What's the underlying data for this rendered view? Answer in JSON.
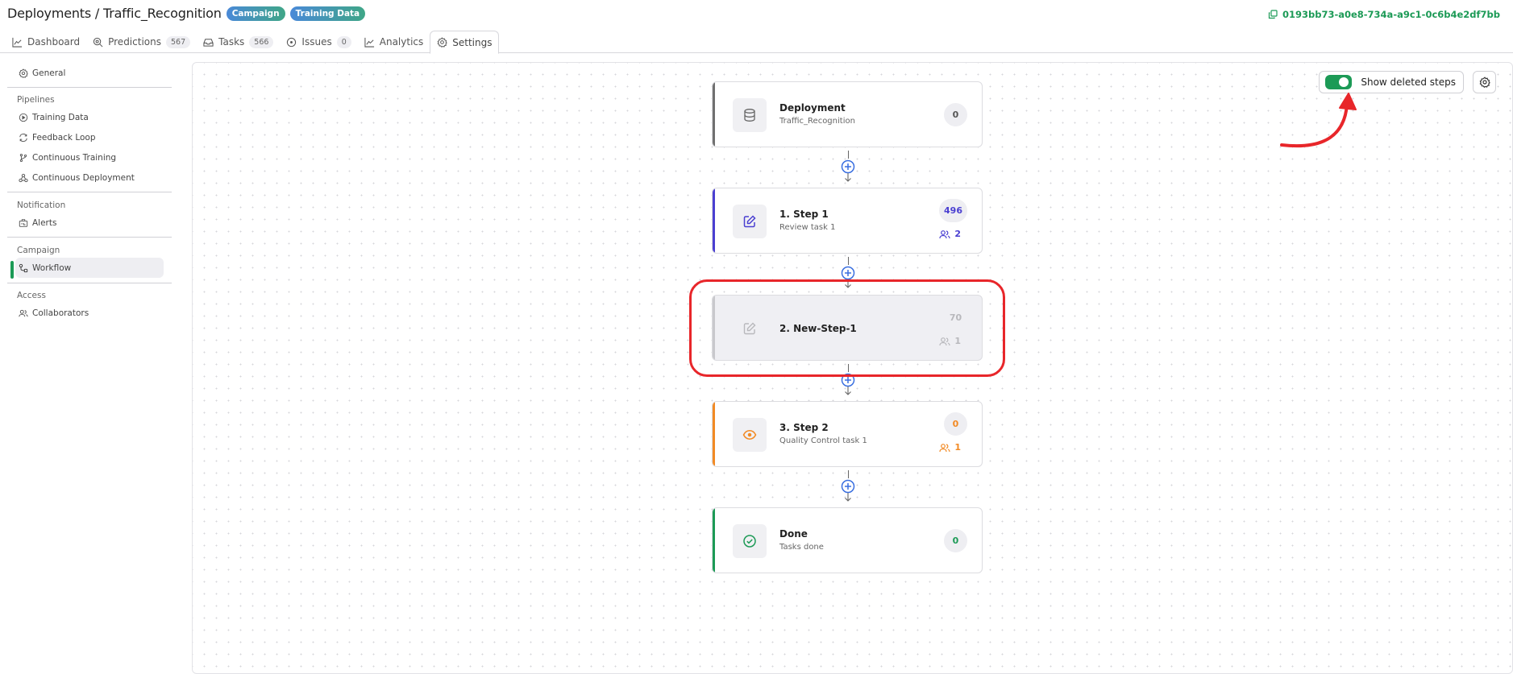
{
  "header": {
    "title": "Deployments / Traffic_Recognition",
    "badges": [
      "Campaign",
      "Training Data"
    ],
    "uuid": "0193bb73-a0e8-734a-a9c1-0c6b4e2df7bb"
  },
  "tabs": [
    {
      "label": "Dashboard",
      "icon": "chart-line-icon"
    },
    {
      "label": "Predictions",
      "count": "567",
      "icon": "search-icon"
    },
    {
      "label": "Tasks",
      "count": "566",
      "icon": "inbox-icon"
    },
    {
      "label": "Issues",
      "count": "0",
      "icon": "dot-circle-icon"
    },
    {
      "label": "Analytics",
      "icon": "chart-line-icon"
    },
    {
      "label": "Settings",
      "icon": "gear-icon",
      "active": true
    }
  ],
  "sidebar": {
    "general": "General",
    "pipelines": {
      "header": "Pipelines",
      "items": [
        "Training Data",
        "Feedback Loop",
        "Continuous Training",
        "Continuous Deployment"
      ]
    },
    "notification": {
      "header": "Notification",
      "items": [
        "Alerts"
      ]
    },
    "campaign": {
      "header": "Campaign",
      "items": [
        "Workflow"
      ]
    },
    "access": {
      "header": "Access",
      "items": [
        "Collaborators"
      ]
    }
  },
  "controls": {
    "show_deleted_label": "Show deleted steps",
    "show_deleted_on": true
  },
  "workflow": {
    "nodes": [
      {
        "title": "Deployment",
        "subtitle": "Traffic_Recognition",
        "count": "0",
        "color": "#707070",
        "icon": "database-icon"
      },
      {
        "title": "1. Step 1",
        "subtitle": "Review task 1",
        "count": "496",
        "users": "2",
        "color": "#4a3fd1",
        "icon": "edit-icon"
      },
      {
        "title": "2. New-Step-1",
        "subtitle": "",
        "count": "70",
        "users": "1",
        "color": "#c8c8cc",
        "icon": "edit-icon",
        "deleted": true
      },
      {
        "title": "3. Step 2",
        "subtitle": "Quality Control task 1",
        "count": "0",
        "users": "1",
        "color": "#f28a24",
        "icon": "eye-icon"
      },
      {
        "title": "Done",
        "subtitle": "Tasks done",
        "count": "0",
        "color": "#1c9a56",
        "icon": "check-circle-icon"
      }
    ]
  },
  "colors": {
    "accent_green": "#1c9a56",
    "annotation_red": "#e8262a",
    "add_blue": "#3a6fe0"
  }
}
